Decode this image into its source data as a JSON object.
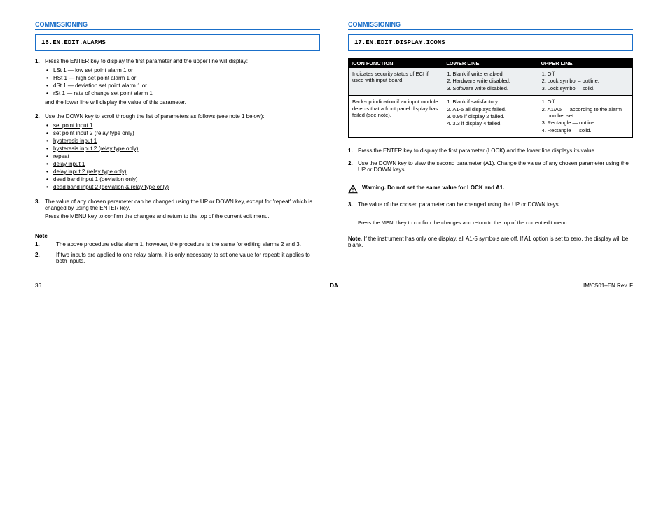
{
  "left": {
    "section_title": "COMMISSIONING",
    "box_cmd": "16.EN.EDIT.ALARMS",
    "step1_num": "1.",
    "step1_p1": "Press the ENTER key to display the first parameter and the upper line will display:",
    "step1_bullets": [
      "LSt 1   —  low set point alarm 1 or",
      "HSt 1   —  high set point alarm 1 or",
      "dSt 1   —  deviation set point alarm 1 or",
      "rSt 1   —  rate of change set point alarm 1"
    ],
    "step1_p2": "and the lower line will display the value of this parameter.",
    "step2_num": "2.",
    "step2_p1": "Use the DOWN key to scroll through the list of parameters as follows (see note 1 below):",
    "step2_list": [
      "set point input 1",
      "set point input 2 (relay type only)",
      "hysteresis input 1",
      "hysteresis input 2 (relay type only)",
      "repeat",
      "delay input 1",
      "delay input 2 (relay type only)",
      "dead band input 1 (deviation only)",
      "dead band input 2 (deviation & relay type only)"
    ],
    "step3_num": "3.",
    "step3_p1": "The value of any chosen parameter can be changed using the UP or DOWN key, except for 'repeat' which is changed by using the ENTER key.",
    "step3_p2": "Press the MENU key to confirm the changes and return to the top of the current edit menu.",
    "note_label": "Note",
    "note1_num": "1.",
    "note1_text": "The above procedure edits alarm 1, however, the procedure is the same for editing alarms 2 and 3.",
    "note2_num": "2.",
    "note2_text": "If two inputs are applied to one relay alarm, it is only necessary to set one value for repeat; it applies to both inputs."
  },
  "right": {
    "section_title": "COMMISSIONING",
    "box_cmd": "17.EN.EDIT.DISPLAY.ICONS",
    "table": {
      "headers": [
        "ICON FUNCTION",
        "LOWER LINE",
        "UPPER LINE"
      ],
      "rows": [
        {
          "grey": true,
          "cells": [
            {
              "p": "Indicates security status of ECI if used with input board.",
              "bullets": []
            },
            {
              "p": "",
              "bullets": [
                {
                  "b": "1.",
                  "t": "Blank if write enabled."
                },
                {
                  "b": "2.",
                  "t": "Hardware write disabled."
                },
                {
                  "b": "3.",
                  "t": "Software write disabled."
                }
              ]
            },
            {
              "p": "",
              "bullets": [
                {
                  "b": "1.",
                  "t": "Off."
                },
                {
                  "b": "2.",
                  "t": "Lock symbol – outline."
                },
                {
                  "b": "3.",
                  "t": "Lock symbol – solid."
                }
              ]
            }
          ]
        },
        {
          "grey": false,
          "cells": [
            {
              "p": "Back-up indication if an input module detects that a front panel display has failed (see note).",
              "bullets": []
            },
            {
              "p": "",
              "bullets": [
                {
                  "b": "1.",
                  "t": "Blank if satisfactory."
                },
                {
                  "b": "2.",
                  "t": "A1-5 all displays failed."
                },
                {
                  "b": "3.",
                  "t": "0.95 if display 2 failed."
                },
                {
                  "b": "4.",
                  "t": "3.3 if display 4 failed."
                }
              ]
            },
            {
              "p": "",
              "bullets": [
                {
                  "b": "1.",
                  "t": "Off."
                },
                {
                  "b": "2.",
                  "t": "A1/A5 — according to the alarm number set."
                },
                {
                  "b": "3.",
                  "t": "Rectangle — outline."
                },
                {
                  "b": "4.",
                  "t": "Rectangle — solid."
                }
              ]
            }
          ]
        }
      ]
    },
    "step1_num": "1.",
    "step1_text": "Press the ENTER key to display the first parameter (LOCK) and the lower line displays its value.",
    "step2_num": "2.",
    "step2_text": "Use the DOWN key to view the second parameter (A1). Change the value of any chosen parameter using the UP or DOWN keys.",
    "warning_text": "Warning. Do not set the same value for LOCK and A1.",
    "step3_num": "3.",
    "step3_text": "The value of the chosen parameter can be changed using the UP or DOWN keys.",
    "result_para": "Press the MENU key to confirm the changes and return to the top of the current edit menu.",
    "note_label": "Note.",
    "note_text": "If the instrument has only one display, all A1-5 symbols are off. If A1 option is set to zero, the display will be blank."
  },
  "footer": {
    "left": "36",
    "mid": "DA",
    "right": "IM/C501–EN Rev. F"
  }
}
